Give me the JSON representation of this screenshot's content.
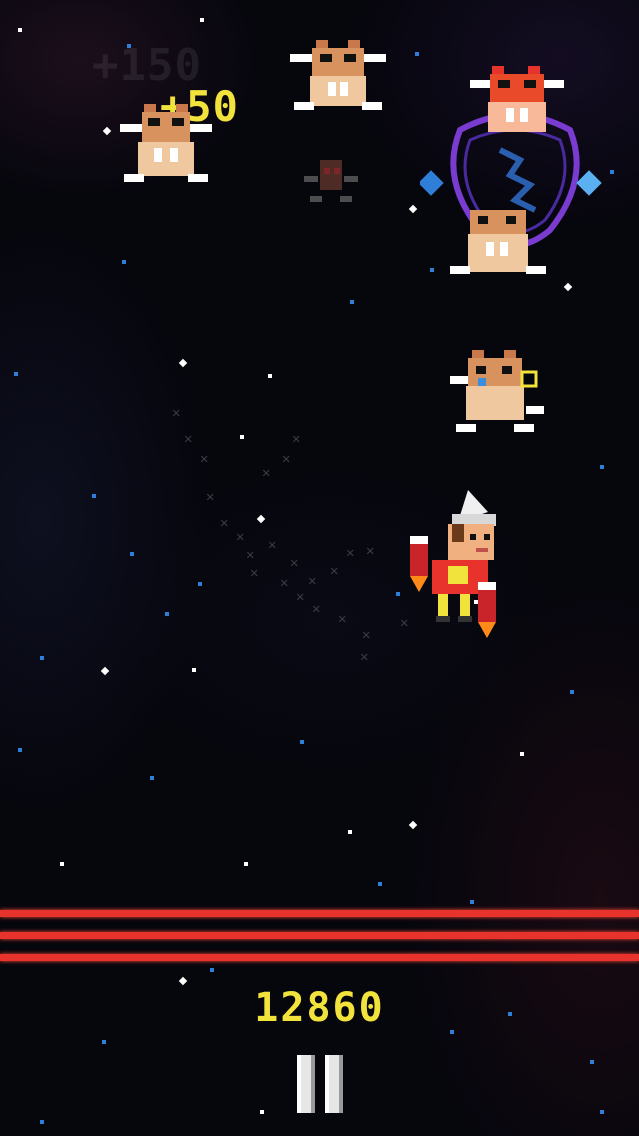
{
  "hud": {
    "score": "12860",
    "floating_points": [
      {
        "text": "+150"
      },
      {
        "text": "+50"
      }
    ]
  },
  "colors": {
    "score": "#f2e23c",
    "laser": "#e8322c",
    "star_white": "#ffffff",
    "star_blue": "#2f7fd8",
    "enemy_fur": "#c8784a",
    "enemy_boss": "#e84a2a",
    "shield": "#7a3cd0"
  },
  "icons": {
    "pause": "pause-icon",
    "player": "jetpack-hero-sprite",
    "enemy": "horned-critter-sprite"
  }
}
